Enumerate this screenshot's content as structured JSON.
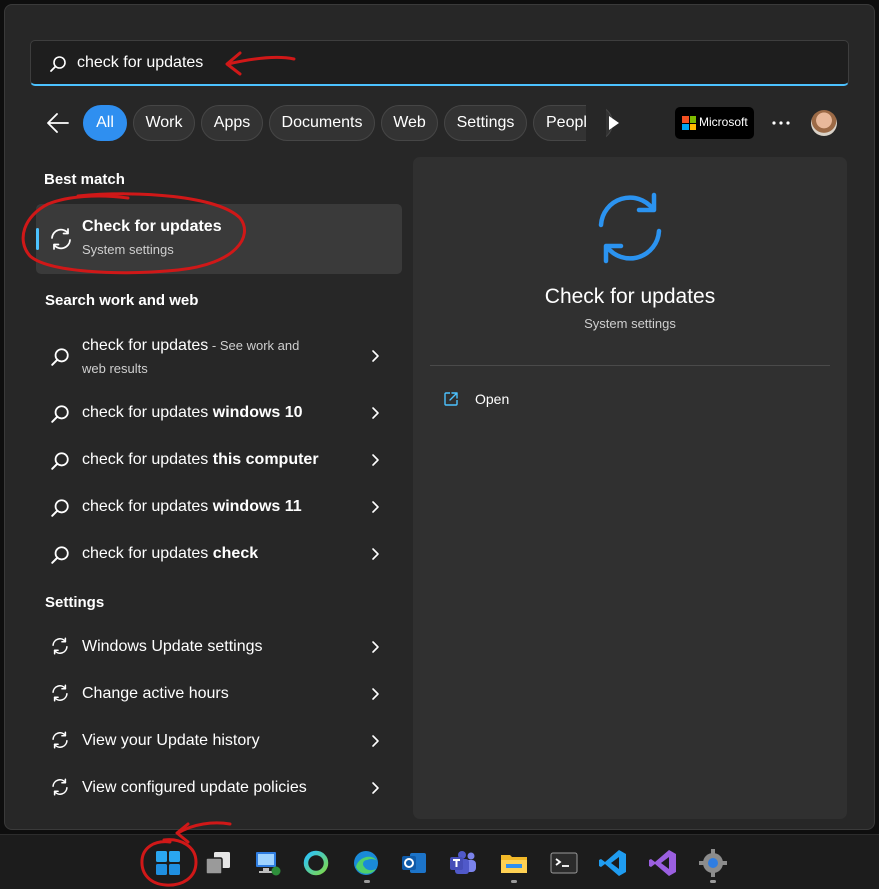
{
  "search": {
    "query": "check for updates",
    "icon": "search-icon"
  },
  "filters": {
    "back_icon": "back-arrow-icon",
    "chips": [
      "All",
      "Work",
      "Apps",
      "Documents",
      "Web",
      "Settings",
      "People"
    ],
    "active": "All",
    "next_icon": "play-icon",
    "brand_label": "Microsoft",
    "more_icon": "more-icon"
  },
  "best_match": {
    "heading": "Best match",
    "title": "Check for updates",
    "subtitle": "System settings",
    "icon": "sync-icon"
  },
  "web": {
    "heading": "Search work and web",
    "first": {
      "query": "check for updates",
      "suffix": " - See work and",
      "suffix2": "web results"
    },
    "items": [
      {
        "prefix": "check for updates ",
        "bold": "windows 10"
      },
      {
        "prefix": "check for updates ",
        "bold": "this computer"
      },
      {
        "prefix": "check for updates ",
        "bold": "windows 11"
      },
      {
        "prefix": "check for updates ",
        "bold": "check"
      }
    ]
  },
  "settings": {
    "heading": "Settings",
    "items": [
      "Windows Update settings",
      "Change active hours",
      "View your Update history",
      "View configured update policies"
    ]
  },
  "preview": {
    "title": "Check for updates",
    "subtitle": "System settings",
    "action_label": "Open",
    "action_icon": "open-external-icon"
  },
  "taskbar": {
    "apps": [
      "start",
      "task-view",
      "remote-desktop",
      "cortana",
      "edge",
      "outlook",
      "teams",
      "file-explorer",
      "terminal",
      "vscode",
      "visual-studio",
      "settings"
    ]
  },
  "colors": {
    "accent": "#4cc2ff",
    "chip_active": "#2f8ff0",
    "annotation": "#d01818",
    "sync_icon": "#2b93f0"
  }
}
